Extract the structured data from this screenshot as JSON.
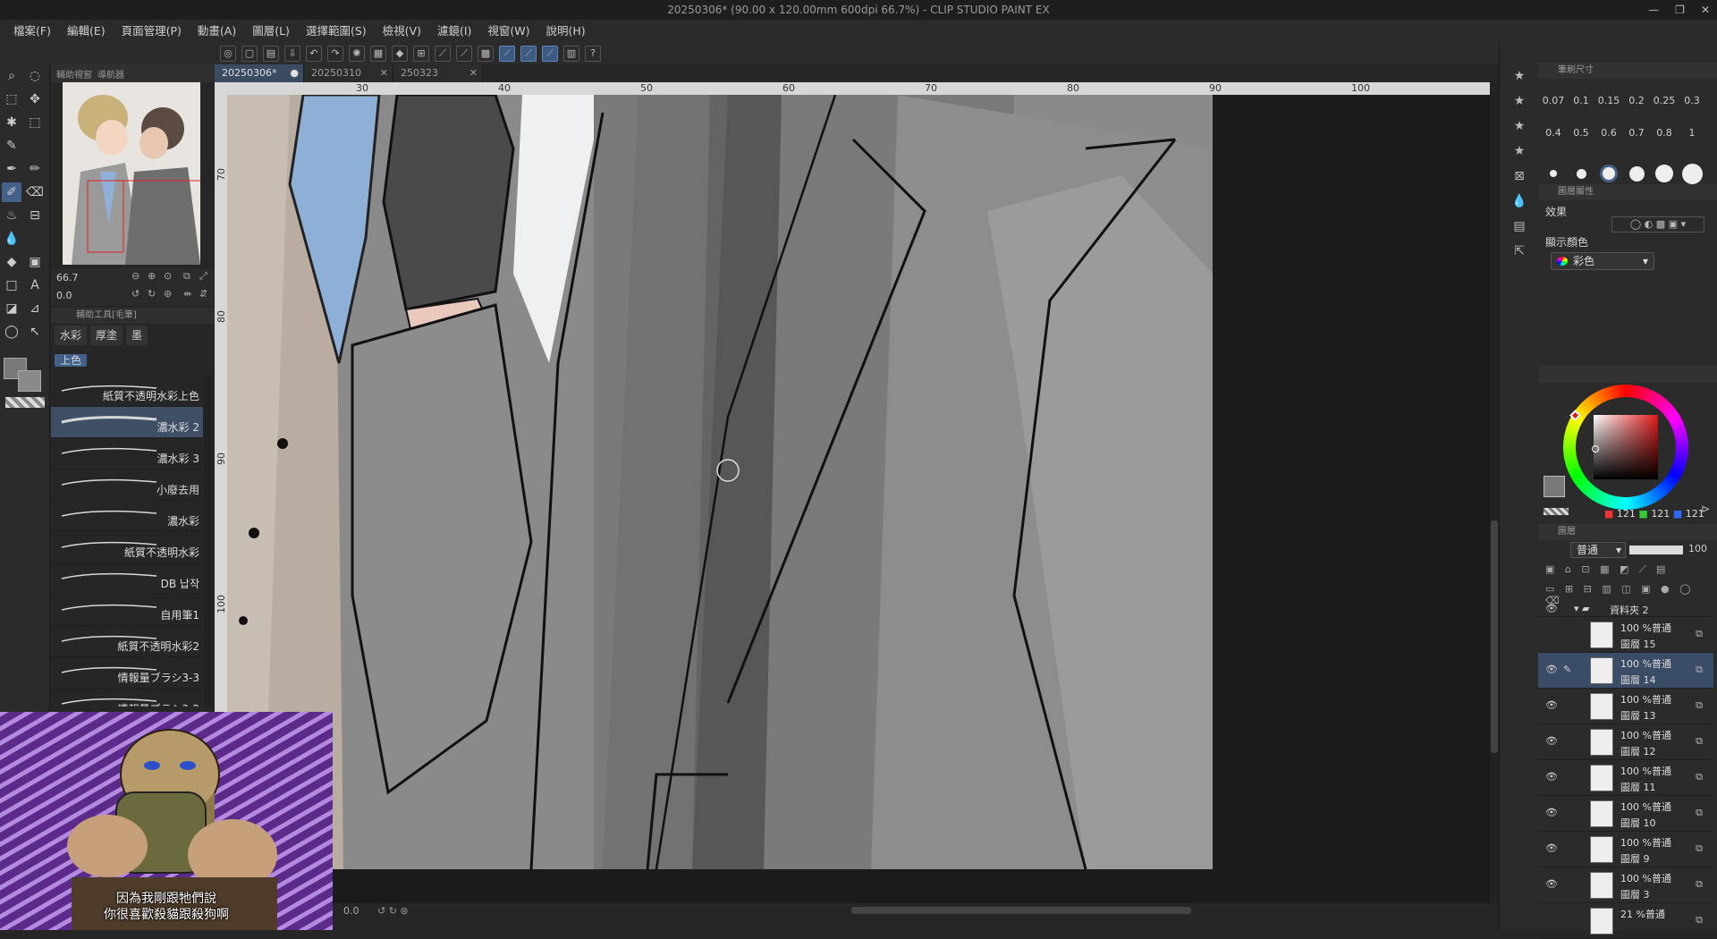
{
  "window": {
    "title": "20250306* (90.00 x 120.00mm 600dpi 66.7%) - CLIP STUDIO PAINT EX",
    "controls": [
      "—",
      "❐",
      "✕"
    ]
  },
  "menu": [
    "檔案(F)",
    "編輯(E)",
    "頁面管理(P)",
    "動畫(A)",
    "圖層(L)",
    "選擇範圍(S)",
    "檢視(V)",
    "濾鏡(I)",
    "視窗(W)",
    "說明(H)"
  ],
  "navigator": {
    "tabs": [
      "輔助視窗",
      "導航器"
    ],
    "zoom": "66.7",
    "rotate": "0.0"
  },
  "subtool": {
    "header": "輔助工具[毛筆]",
    "tabs": [
      "水彩",
      "厚塗",
      "墨"
    ],
    "group": "上色",
    "brushes": [
      "紙質不透明水彩上色",
      "濃水彩 2",
      "濃水彩 3",
      "小廢去用",
      "濃水彩",
      "紙質不透明水彩",
      "DB 납작",
      "自用筆1",
      "紙質不透明水彩2",
      "情報量ブラシ3-3",
      "情報量ブラシ3-2"
    ],
    "selected_index": 1
  },
  "overlay": {
    "subtitle_1": "因為我剛跟牠們說",
    "subtitle_2": "你很喜歡殺貓跟殺狗啊"
  },
  "doc_tabs": [
    {
      "label": "20250306*",
      "active": true
    },
    {
      "label": "20250310",
      "active": false
    },
    {
      "label": "250323",
      "active": false
    }
  ],
  "ruler": {
    "h": [
      "30",
      "40",
      "50",
      "60",
      "70",
      "80",
      "90",
      "100"
    ],
    "v": [
      "70",
      "80",
      "90",
      "100"
    ]
  },
  "status": {
    "angle": "0.0"
  },
  "brush_size": {
    "header": "筆刷尺寸",
    "sizes": [
      "0.07",
      "0.1",
      "0.15",
      "0.2",
      "0.25",
      "0.3",
      "0.4",
      "0.5",
      "0.6",
      "0.7",
      "0.8",
      "1"
    ]
  },
  "layer_property": {
    "header": "圖層屬性",
    "effect_label": "效果",
    "display_color_label": "顯示顏色",
    "display_color_value": "彩色"
  },
  "color": {
    "r": "121",
    "g": "121",
    "b": "121",
    "main": "#797979"
  },
  "layers": {
    "header": "圖層",
    "blend_mode": "普通",
    "opacity": "100",
    "folder": "資料夾 2",
    "folder_mode": "100 %普通",
    "rows": [
      {
        "mode": "100 %普通",
        "name": "圖層 15",
        "selected": false,
        "visible": false
      },
      {
        "mode": "100 %普通",
        "name": "圖層 14",
        "selected": true,
        "visible": true
      },
      {
        "mode": "100 %普通",
        "name": "圖層 13",
        "selected": false,
        "visible": true
      },
      {
        "mode": "100 %普通",
        "name": "圖層 12",
        "selected": false,
        "visible": true
      },
      {
        "mode": "100 %普通",
        "name": "圖層 11",
        "selected": false,
        "visible": true
      },
      {
        "mode": "100 %普通",
        "name": "圖層 10",
        "selected": false,
        "visible": true
      },
      {
        "mode": "100 %普通",
        "name": "圖層 9",
        "selected": false,
        "visible": true
      },
      {
        "mode": "100 %普通",
        "name": "圖層 3",
        "selected": false,
        "visible": true
      },
      {
        "mode": "21 %普通",
        "name": "",
        "selected": false,
        "visible": false
      }
    ]
  }
}
